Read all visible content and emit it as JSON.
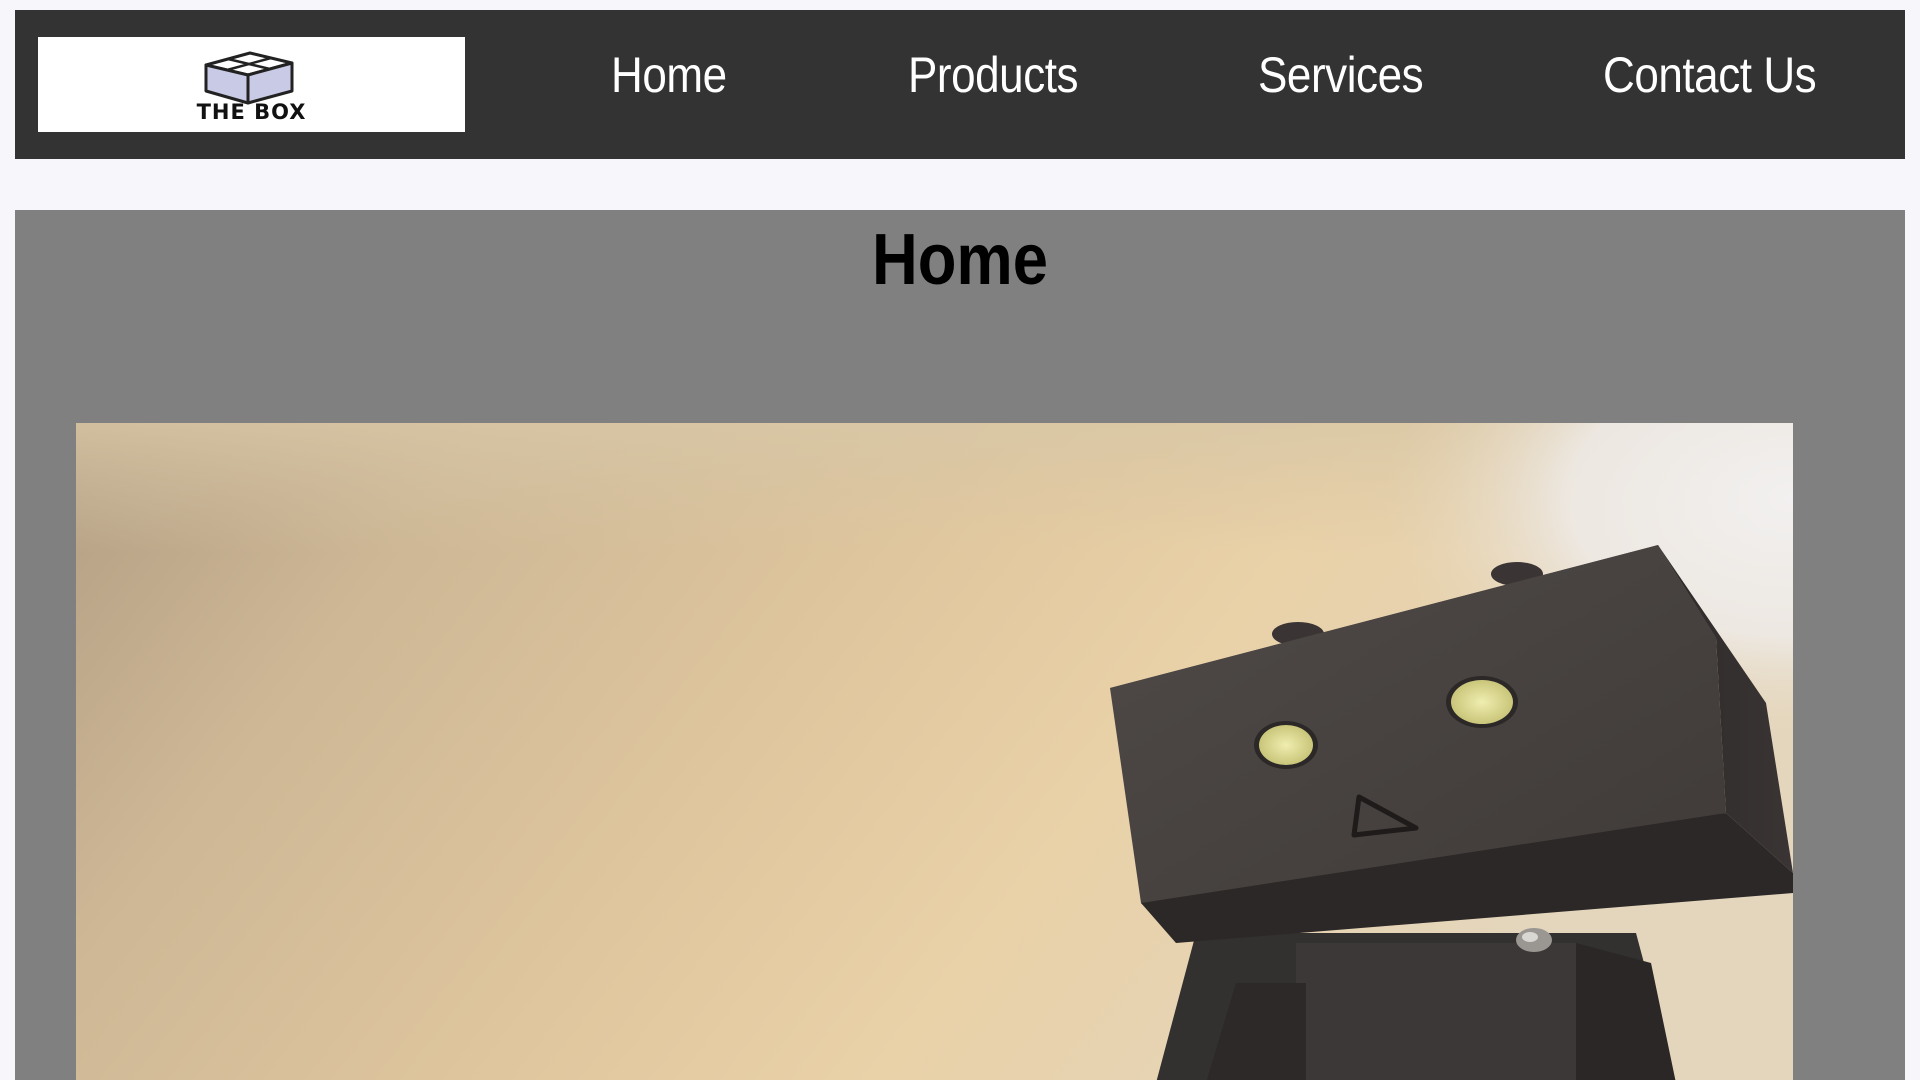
{
  "header": {
    "logo": {
      "text": "THE BOX",
      "icon": "box-logo-icon"
    },
    "nav": [
      {
        "label": "Home"
      },
      {
        "label": "Products"
      },
      {
        "label": "Services"
      },
      {
        "label": "Contact Us"
      }
    ]
  },
  "main": {
    "title": "Home",
    "hero_image": "danboard-robot-photo"
  },
  "colors": {
    "page_background": "#f7f7fb",
    "navbar_background": "#333333",
    "nav_text": "#ffffff",
    "content_background": "#808080",
    "title_text": "#000000"
  }
}
